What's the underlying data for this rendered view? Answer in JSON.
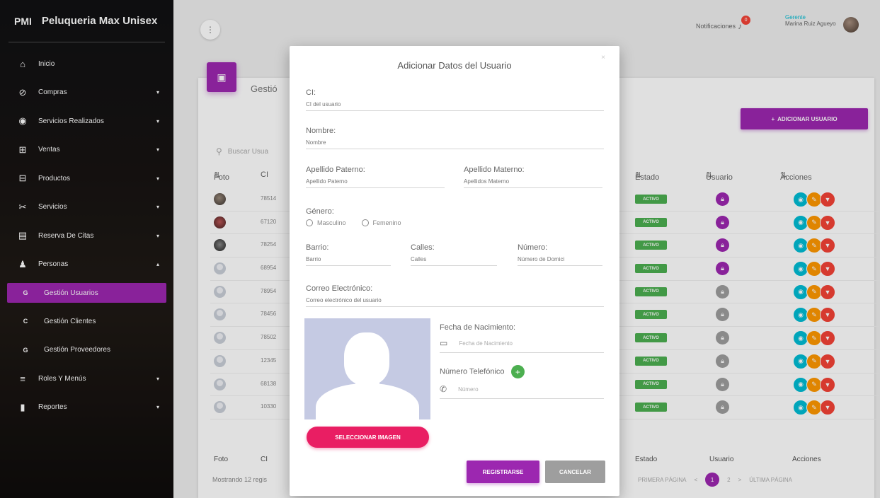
{
  "sidebar": {
    "abbr": "PMI",
    "app_name": "Peluqueria Max Unisex",
    "items": [
      {
        "icon": "home-icon",
        "glyph": "⌂",
        "label": "Inicio",
        "caret": ""
      },
      {
        "icon": "cart-off-icon",
        "glyph": "⊘",
        "label": "Compras",
        "caret": "▾"
      },
      {
        "icon": "service-icon",
        "glyph": "◉",
        "label": "Servicios Realizados",
        "caret": "▾"
      },
      {
        "icon": "cart-icon",
        "glyph": "⊞",
        "label": "Ventas",
        "caret": "▾"
      },
      {
        "icon": "products-icon",
        "glyph": "⊟",
        "label": "Productos",
        "caret": "▾"
      },
      {
        "icon": "scissors-icon",
        "glyph": "✂",
        "label": "Servicios",
        "caret": "▾"
      },
      {
        "icon": "calendar-icon",
        "glyph": "▤",
        "label": "Reserva De Citas",
        "caret": "▾"
      },
      {
        "icon": "person-icon",
        "glyph": "♟",
        "label": "Personas",
        "caret": "▴"
      }
    ],
    "subitems": [
      {
        "letter": "G",
        "label": "Gestión Usuarios"
      },
      {
        "letter": "C",
        "label": "Gestión Clientes"
      },
      {
        "letter": "G",
        "label": "Gestión Proveedores"
      }
    ],
    "items_after": [
      {
        "icon": "list-icon",
        "glyph": "≡",
        "label": "Roles Y Menús",
        "caret": "▾"
      },
      {
        "icon": "report-icon",
        "glyph": "▮",
        "label": "Reportes",
        "caret": "▾"
      }
    ]
  },
  "topbar": {
    "notifications_label": "Notificaciones",
    "notifications_count": "0",
    "user_role": "Gerente",
    "user_name": "Marina Ruiz Agueyo"
  },
  "page": {
    "title": "Gestió",
    "add_button": "ADICIONAR USUARIO",
    "search_placeholder": "Buscar Usua",
    "columns": {
      "foto": "Foto",
      "ci": "CI",
      "estado": "Estado",
      "usuario": "Usuario",
      "acciones": "Acciones"
    },
    "rows": [
      {
        "ci": "78514",
        "photo": "person",
        "estado": "ACTIVO",
        "user_on": true
      },
      {
        "ci": "67120",
        "photo": "person2",
        "estado": "ACTIVO",
        "user_on": true
      },
      {
        "ci": "78254",
        "photo": "person3",
        "estado": "ACTIVO",
        "user_on": true
      },
      {
        "ci": "68954",
        "photo": "placeholder",
        "estado": "ACTIVO",
        "user_on": true
      },
      {
        "ci": "78954",
        "photo": "placeholder",
        "estado": "ACTIVO",
        "user_on": false
      },
      {
        "ci": "78456",
        "photo": "placeholder",
        "estado": "ACTIVO",
        "user_on": false
      },
      {
        "ci": "78502",
        "photo": "placeholder",
        "estado": "ACTIVO",
        "user_on": false
      },
      {
        "ci": "12345",
        "photo": "placeholder",
        "estado": "ACTIVO",
        "user_on": false
      },
      {
        "ci": "68138",
        "photo": "placeholder",
        "estado": "ACTIVO",
        "user_on": false
      },
      {
        "ci": "10330",
        "photo": "placeholder",
        "estado": "ACTIVO",
        "user_on": false
      }
    ],
    "showing": "Mostrando 12 regis",
    "pager": {
      "first": "PRIMERA PÁGINA",
      "prev": "<",
      "current": "1",
      "next_page": "2",
      "next": ">",
      "last": "ÚLTIMA PÁGINA"
    }
  },
  "modal": {
    "title": "Adicionar Datos del Usuario",
    "close": "×",
    "ci_label": "CI:",
    "ci_placeholder": "CI del usuario",
    "nombre_label": "Nombre:",
    "nombre_placeholder": "Nombre",
    "paterno_label": "Apellido Paterno:",
    "paterno_placeholder": "Apellido Paterno",
    "materno_label": "Apellido Materno:",
    "materno_placeholder": "Apellidos Materno",
    "genero_label": "Género:",
    "masculino": "Masculino",
    "femenino": "Femenino",
    "barrio_label": "Barrio:",
    "barrio_placeholder": "Barrio",
    "calles_label": "Calles:",
    "calles_placeholder": "Calles",
    "numero_label": "Número:",
    "numero_placeholder": "Número de Domici",
    "correo_label": "Correo Electrónico:",
    "correo_placeholder": "Correo electrónico del usuario",
    "fecha_label": "Fecha de Nacimiento:",
    "fecha_placeholder": "Fecha de Nacimiento",
    "telefono_label": "Número Telefónico",
    "telefono_placeholder": "Número",
    "select_image": "SELECCIONAR IMAGEN",
    "register": "REGISTRARSE",
    "cancel": "CANCELAR"
  }
}
